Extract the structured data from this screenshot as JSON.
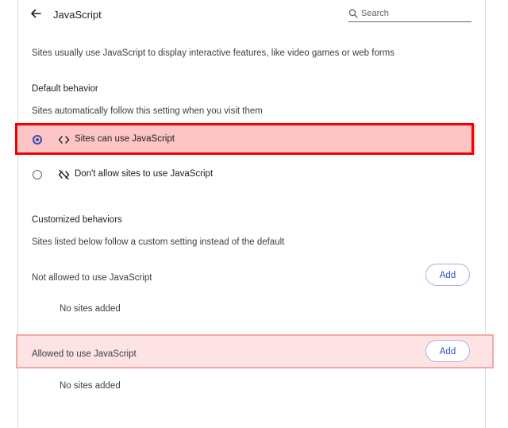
{
  "header": {
    "title": "JavaScript",
    "search_placeholder": "Search"
  },
  "description": "Sites usually use JavaScript to display interactive features, like video games or web forms",
  "default_behavior": {
    "heading": "Default behavior",
    "subtitle": "Sites automatically follow this setting when you visit them",
    "options": [
      {
        "label": "Sites can use JavaScript",
        "selected": true,
        "icon": "code-icon"
      },
      {
        "label": "Don't allow sites to use JavaScript",
        "selected": false,
        "icon": "code-off-icon"
      }
    ]
  },
  "customized": {
    "heading": "Customized behaviors",
    "subtitle": "Sites listed below follow a custom setting instead of the default",
    "not_allowed": {
      "label": "Not allowed to use JavaScript",
      "add_label": "Add",
      "empty": "No sites added"
    },
    "allowed": {
      "label": "Allowed to use JavaScript",
      "add_label": "Add",
      "empty": "No sites added"
    }
  },
  "colors": {
    "accent": "#3d4cad",
    "selected_row": "#fdc5c5",
    "highlight_red": "#f00000",
    "pink_row": "#fde3e3"
  }
}
